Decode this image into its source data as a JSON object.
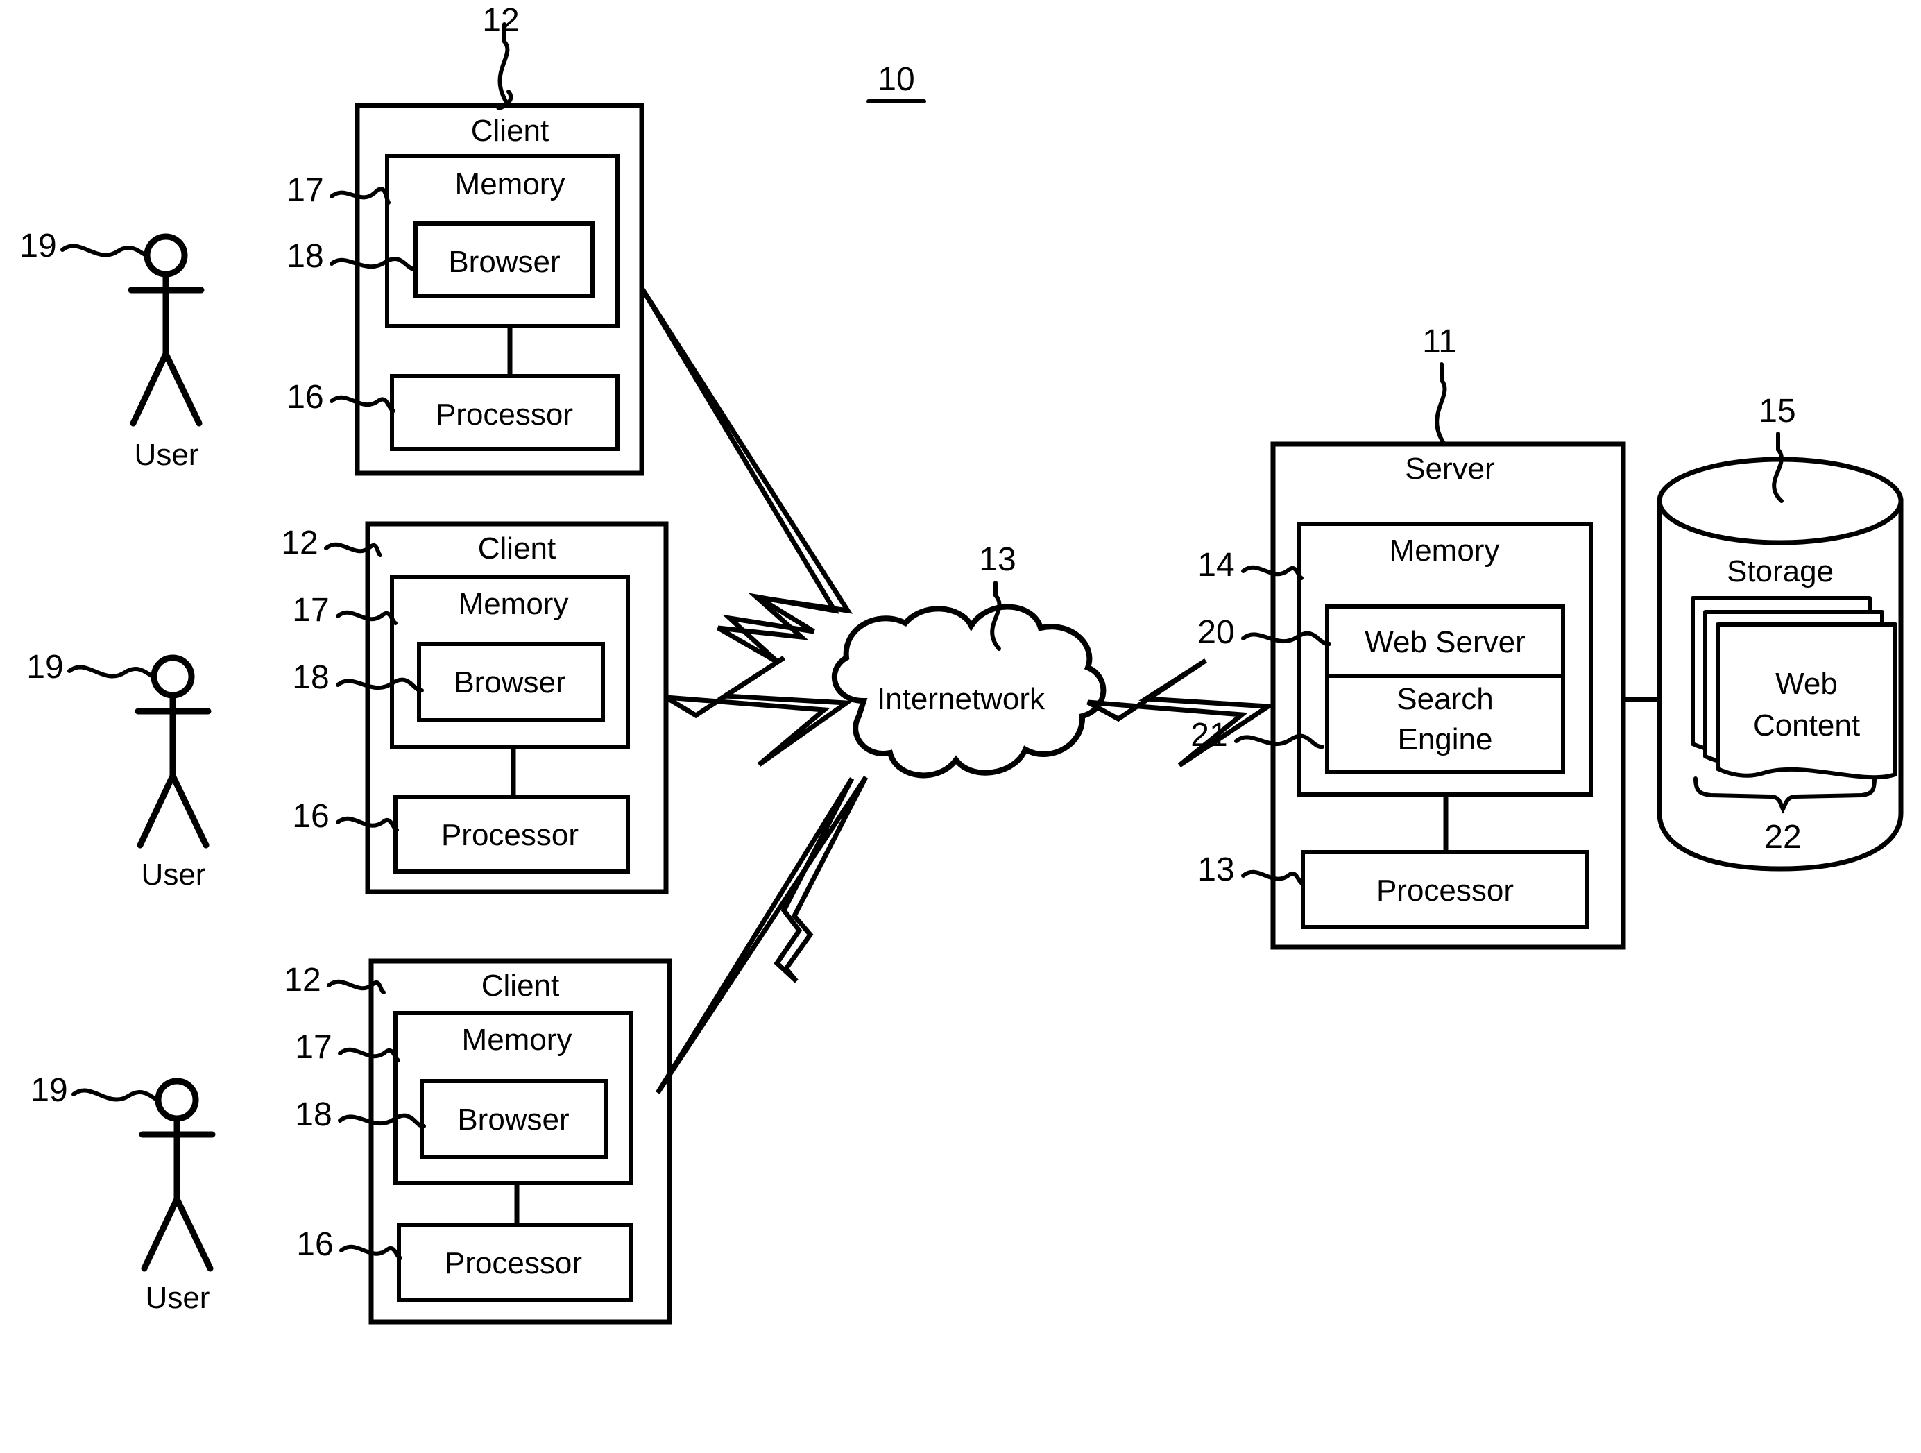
{
  "figure": {
    "figure_number": "10",
    "title_label": "10"
  },
  "clients": [
    {
      "id": "client-1",
      "client_label": "Client",
      "client_ref": "12",
      "memory_label": "Memory",
      "memory_ref": "17",
      "browser_label": "Browser",
      "browser_ref": "18",
      "processor_label": "Processor",
      "processor_ref": "16",
      "user_label": "User",
      "user_ref": "19"
    },
    {
      "id": "client-2",
      "client_label": "Client",
      "client_ref": "12",
      "memory_label": "Memory",
      "memory_ref": "17",
      "browser_label": "Browser",
      "browser_ref": "18",
      "processor_label": "Processor",
      "processor_ref": "16",
      "user_label": "User",
      "user_ref": "19"
    },
    {
      "id": "client-3",
      "client_label": "Client",
      "client_ref": "12",
      "memory_label": "Memory",
      "memory_ref": "17",
      "browser_label": "Browser",
      "browser_ref": "18",
      "processor_label": "Processor",
      "processor_ref": "16",
      "user_label": "User",
      "user_ref": "19"
    }
  ],
  "network": {
    "label": "Internetwork",
    "ref": "13"
  },
  "server": {
    "label": "Server",
    "ref": "11",
    "memory_label": "Memory",
    "memory_ref": "14",
    "web_server_label": "Web Server",
    "web_server_ref": "20",
    "search_engine_label_line1": "Search",
    "search_engine_label_line2": "Engine",
    "search_engine_ref": "21",
    "processor_label": "Processor",
    "processor_ref": "13"
  },
  "storage": {
    "label": "Storage",
    "ref": "15",
    "web_content_line1": "Web",
    "web_content_line2": "Content",
    "web_content_ref": "22"
  },
  "colors": {
    "ink": "#000000",
    "paper": "#ffffff"
  }
}
